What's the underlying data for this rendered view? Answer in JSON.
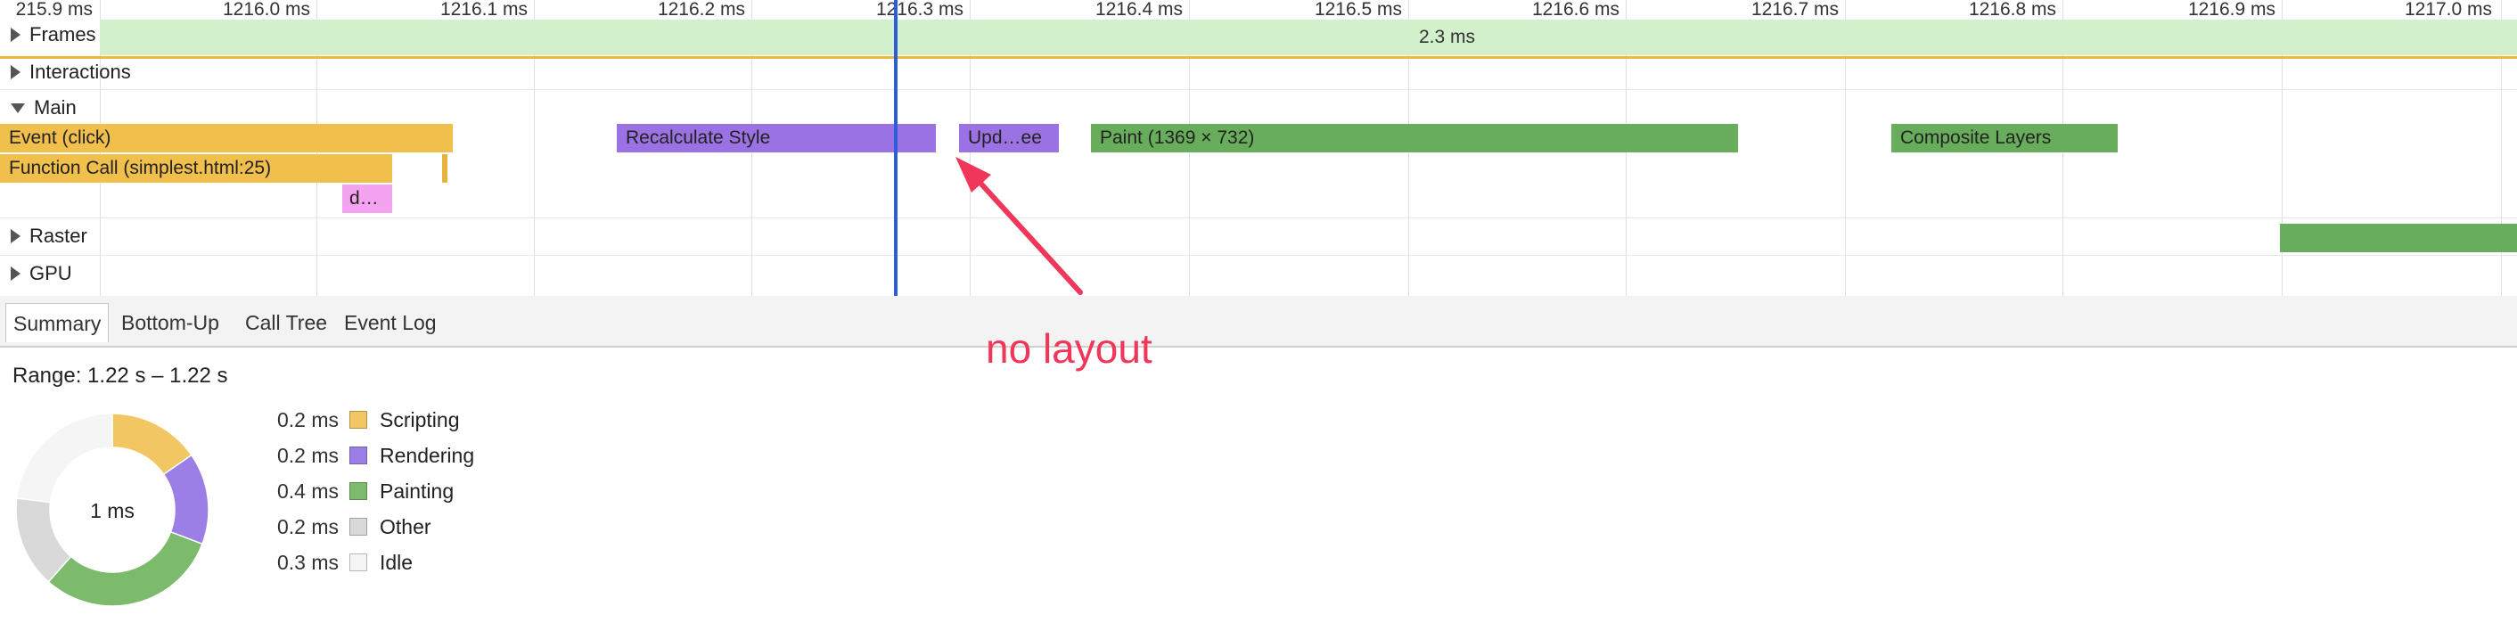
{
  "ruler": {
    "labels": [
      "215.9 ms",
      "1216.0 ms",
      "1216.1 ms",
      "1216.2 ms",
      "1216.3 ms",
      "1216.4 ms",
      "1216.5 ms",
      "1216.6 ms",
      "1216.7 ms",
      "1216.8 ms",
      "1216.9 ms",
      "1217.0 ms"
    ]
  },
  "tracks": {
    "frames": {
      "label": "Frames",
      "duration": "2.3 ms"
    },
    "interactions": {
      "label": "Interactions"
    },
    "main": {
      "label": "Main"
    },
    "raster": {
      "label": "Raster"
    },
    "gpu": {
      "label": "GPU"
    }
  },
  "events": {
    "event_click": "Event (click)",
    "function_call": "Function Call (simplest.html:25)",
    "d_truncated": "d…",
    "recalculate_style": "Recalculate Style",
    "update_truncated": "Upd…ee",
    "paint": "Paint (1369 × 732)",
    "composite_layers": "Composite Layers"
  },
  "tabs": {
    "summary": "Summary",
    "bottom_up": "Bottom-Up",
    "call_tree": "Call Tree",
    "event_log": "Event Log"
  },
  "summary": {
    "range": "Range: 1.22 s – 1.22 s",
    "total": "1 ms",
    "items": [
      {
        "value": "0.2 ms",
        "label": "Scripting",
        "color": "#f1c663"
      },
      {
        "value": "0.2 ms",
        "label": "Rendering",
        "color": "#9b7fe6"
      },
      {
        "value": "0.4 ms",
        "label": "Painting",
        "color": "#7cba6c"
      },
      {
        "value": "0.2 ms",
        "label": "Other",
        "color": "#d9d9d9"
      },
      {
        "value": "0.3 ms",
        "label": "Idle",
        "color": "#f5f5f5"
      }
    ]
  },
  "annotation": {
    "text": "no layout",
    "color": "#f0375a"
  },
  "colors": {
    "scripting": "#f1bf4c",
    "rendering": "#9b72e3",
    "painting": "#68ad5b",
    "frames": "#d2f0cb",
    "cursor": "#2b5fd9"
  }
}
